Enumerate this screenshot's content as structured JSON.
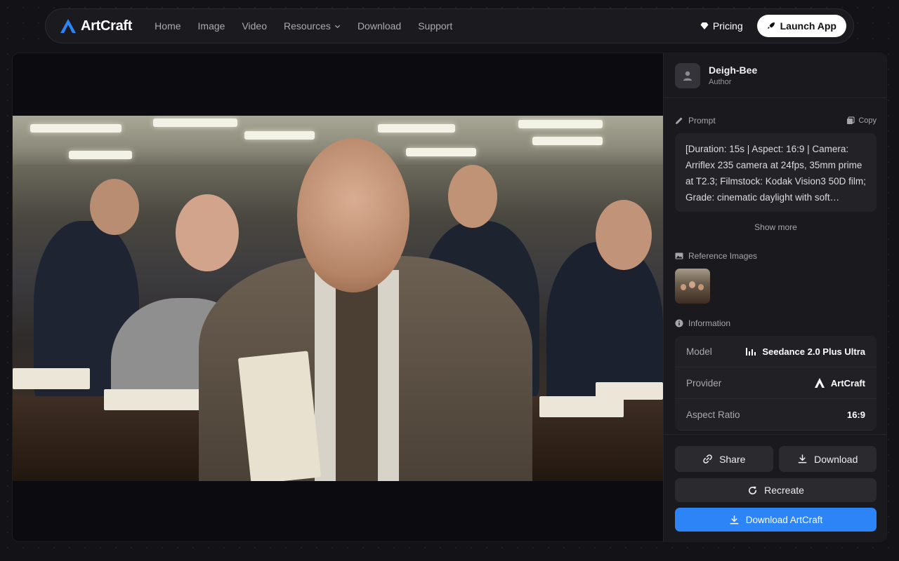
{
  "brand": {
    "name": "ArtCraft"
  },
  "nav": {
    "items": [
      {
        "label": "Home"
      },
      {
        "label": "Image"
      },
      {
        "label": "Video"
      },
      {
        "label": "Resources"
      },
      {
        "label": "Download"
      },
      {
        "label": "Support"
      }
    ],
    "pricing_label": "Pricing",
    "launch_label": "Launch App"
  },
  "author": {
    "name": "Deigh-Bee",
    "role": "Author"
  },
  "prompt": {
    "heading": "Prompt",
    "copy_label": "Copy",
    "text": "[Duration: 15s | Aspect: 16:9 | Camera: Arriflex 235 camera at 24fps, 35mm prime at T2.3; Filmstock: Kodak Vision3 50D film; Grade: cinematic daylight with soft…",
    "show_more_label": "Show more"
  },
  "reference": {
    "heading": "Reference Images"
  },
  "information": {
    "heading": "Information",
    "rows": [
      {
        "key": "Model",
        "value": "Seedance 2.0 Plus Ultra",
        "icon": "bars-chart-icon"
      },
      {
        "key": "Provider",
        "value": "ArtCraft",
        "icon": "artcraft-logo-icon"
      },
      {
        "key": "Aspect Ratio",
        "value": "16:9"
      }
    ]
  },
  "actions": {
    "share_label": "Share",
    "download_label": "Download",
    "recreate_label": "Recreate",
    "download_app_label": "Download ArtCraft"
  },
  "colors": {
    "accent": "#2d84f6",
    "background": "#121217",
    "panel": "#1a1a1e"
  }
}
